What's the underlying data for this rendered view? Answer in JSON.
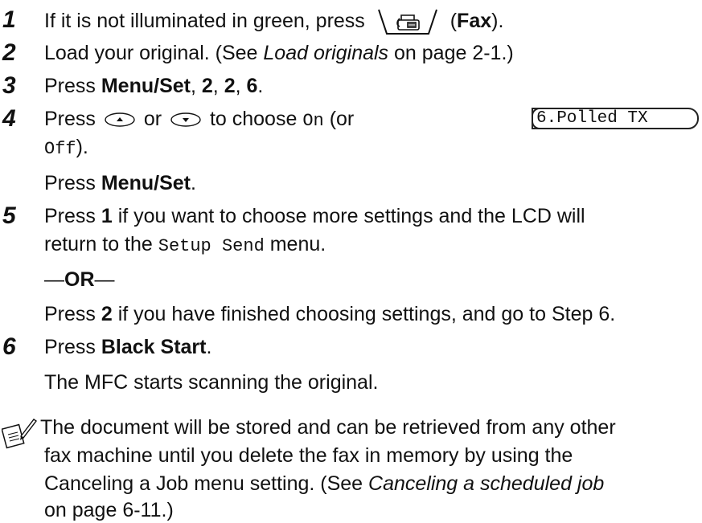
{
  "steps": [
    {
      "number": "1",
      "pre": "If it is not illuminated in green, press",
      "paren_open": "(",
      "key": "Fax",
      "paren_close": ")."
    },
    {
      "number": "2",
      "text": "Load your original. (See ",
      "ref": "Load originals",
      "post": " on page 2-1.)"
    },
    {
      "number": "3",
      "pre": "Press ",
      "key": "Menu/Set",
      "sep1": ", ",
      "k1": "2",
      "sep2": ", ",
      "k2": "2",
      "sep3": ", ",
      "k3": "6",
      "end": "."
    },
    {
      "number": "4",
      "pre": "Press",
      "or": "or",
      "post": "to choose",
      "on": "On",
      "open": "(or",
      "off": "Off",
      "close": ").",
      "line2_pre": "Press ",
      "line2_key": "Menu/Set",
      "line2_end": "."
    },
    {
      "number": "5",
      "pre": "Press ",
      "key": "1",
      "post": " if you want to choose more settings and the LCD will",
      "line2_pre": "return to the ",
      "menu": "Setup Send",
      "line2_post": " menu.",
      "dash_l": "—",
      "or_word": "OR",
      "dash_r": "—",
      "alt_pre": "Press ",
      "alt_key": "2",
      "alt_post": " if you have finished choosing settings, and go to Step 6."
    },
    {
      "number": "6",
      "pre": "Press ",
      "key": "Black Start",
      "end": ".",
      "result": "The MFC starts scanning the original."
    }
  ],
  "lcd": {
    "text": "6.Polled TX"
  },
  "note": {
    "line1": "The document will be stored and can be retrieved from any other",
    "line2": "fax machine until you delete the fax in memory by using the",
    "line3_pre": "Canceling a Job menu setting. (See ",
    "line3_ref": "Canceling a scheduled job",
    "line4": "on page 6-11.)"
  },
  "icons": [
    "fax-key-icon",
    "up-arrow-key-icon",
    "down-arrow-key-icon",
    "note-pencil-icon"
  ]
}
